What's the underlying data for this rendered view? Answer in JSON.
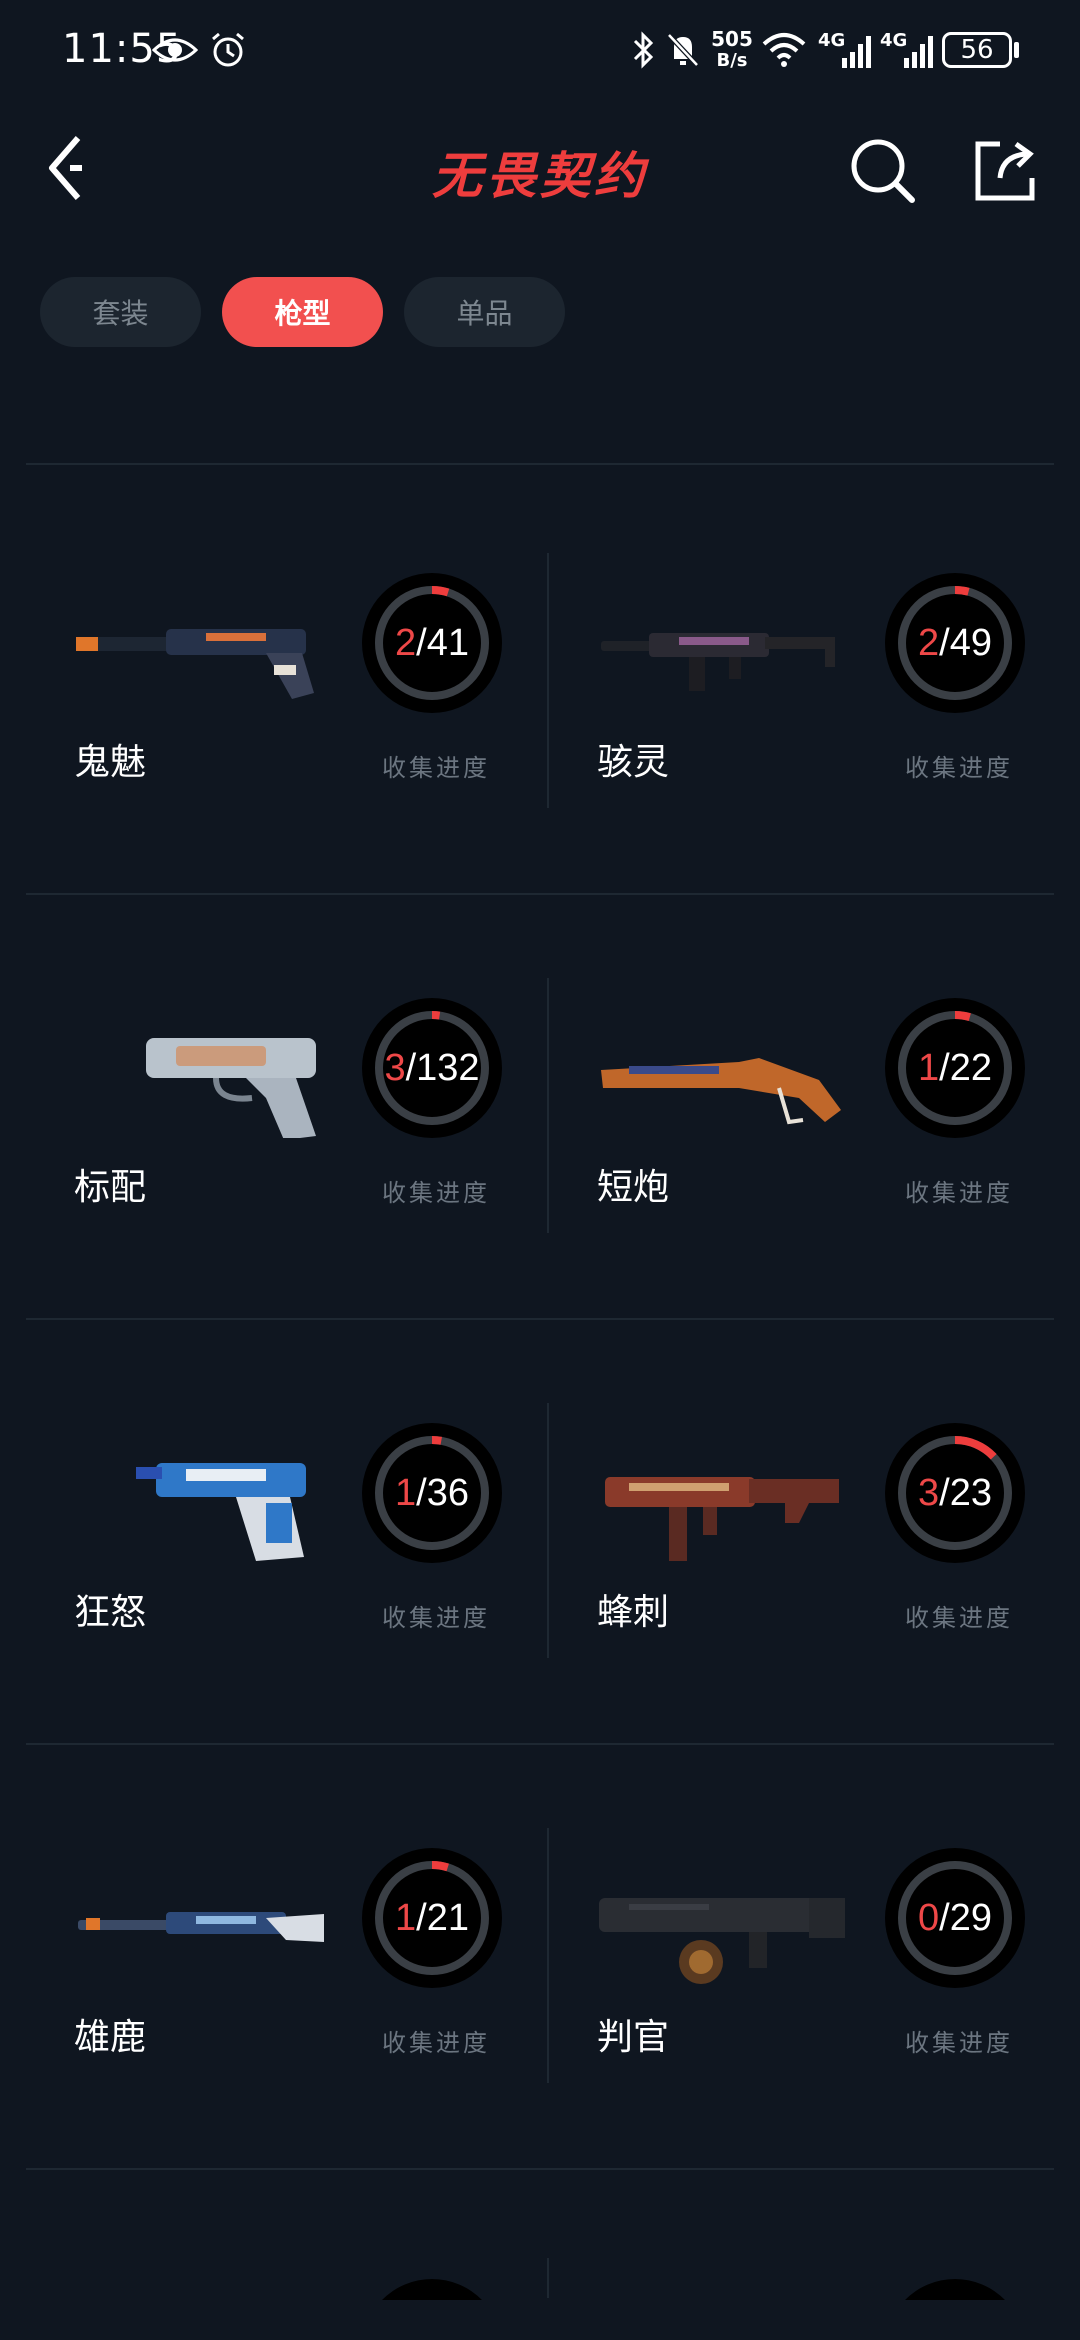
{
  "status_bar": {
    "time": "11:55",
    "net_speed_top": "505",
    "net_speed_bottom": "B/s",
    "signal1": "4G",
    "signal2": "4G",
    "battery": "56"
  },
  "header": {
    "title": "无畏契约"
  },
  "tabs": [
    {
      "label": "套装",
      "active": false
    },
    {
      "label": "枪型",
      "active": true
    },
    {
      "label": "单品",
      "active": false
    }
  ],
  "progress_label": "收集进度",
  "weapons": [
    {
      "name": "鬼魅",
      "collected": "2",
      "total": "/41",
      "fraction": 0.049
    },
    {
      "name": "骇灵",
      "collected": "2",
      "total": "/49",
      "fraction": 0.041
    },
    {
      "name": "标配",
      "collected": "3",
      "total": "/132",
      "fraction": 0.023
    },
    {
      "name": "短炮",
      "collected": "1",
      "total": "/22",
      "fraction": 0.045
    },
    {
      "name": "狂怒",
      "collected": "1",
      "total": "/36",
      "fraction": 0.028
    },
    {
      "name": "蜂刺",
      "collected": "3",
      "total": "/23",
      "fraction": 0.13
    },
    {
      "name": "雄鹿",
      "collected": "1",
      "total": "/21",
      "fraction": 0.048
    },
    {
      "name": "判官",
      "collected": "0",
      "total": "/29",
      "fraction": 0.0
    }
  ],
  "colors": {
    "accent": "#ee3d3d",
    "ring_track": "#3a3f45",
    "ring_bg": "#000000"
  }
}
